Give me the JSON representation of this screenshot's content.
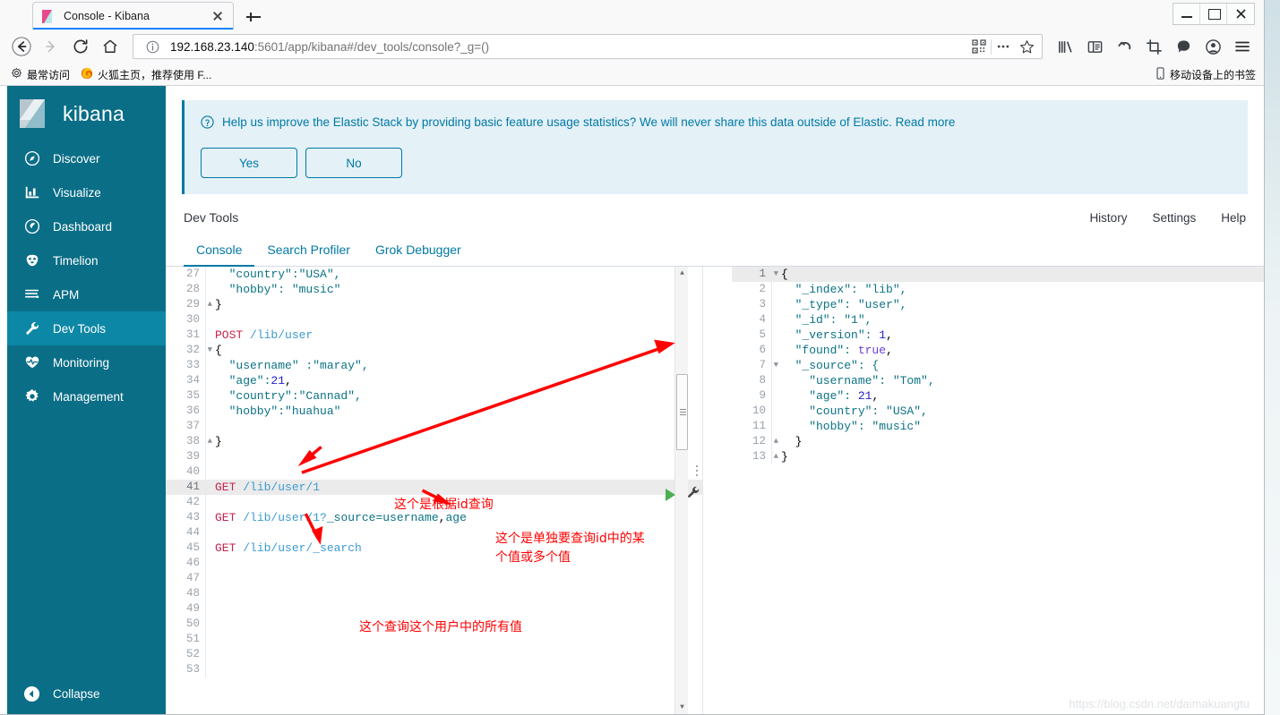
{
  "browser": {
    "tab": {
      "title": "Console - Kibana",
      "favicon": "kibana-favicon",
      "close": "×"
    },
    "newtab_tooltip": "+",
    "window_buttons": {
      "minimize": "minimize-icon",
      "maximize": "maximize-icon",
      "close": "✕"
    },
    "nav": {
      "back": "back-arrow-icon",
      "forward": "forward-arrow-icon",
      "reload": "reload-icon",
      "home": "home-icon"
    },
    "url": {
      "host": "192.168.23.140",
      "rest": ":5601/app/kibana#/dev_tools/console?_g=()",
      "full": "192.168.23.140:5601/app/kibana#/dev_tools/console?_g=()",
      "info_icon": "info-circle-icon",
      "qr_icon": "qr-code-icon",
      "more_icon": "ellipsis-icon",
      "bookmark_icon": "star-icon"
    },
    "toolbar_icons": [
      "library-icon",
      "sidebar-icon",
      "undo-icon",
      "screenshot-icon",
      "pocket-icon",
      "account-icon",
      "menu-icon"
    ],
    "bookmarks": {
      "most_visited": "最常访问",
      "firefox_home": "火狐主页，推荐使用 F...",
      "mobile": "移动设备上的书签"
    }
  },
  "sidebar": {
    "logo_text": "kibana",
    "items": [
      {
        "label": "Discover",
        "icon": "compass-icon",
        "active": false
      },
      {
        "label": "Visualize",
        "icon": "bar-chart-icon",
        "active": false
      },
      {
        "label": "Dashboard",
        "icon": "dashboard-icon",
        "active": false
      },
      {
        "label": "Timelion",
        "icon": "timelion-icon",
        "active": false
      },
      {
        "label": "APM",
        "icon": "apm-icon",
        "active": false
      },
      {
        "label": "Dev Tools",
        "icon": "wrench-icon",
        "active": true
      },
      {
        "label": "Monitoring",
        "icon": "heartbeat-icon",
        "active": false
      },
      {
        "label": "Management",
        "icon": "gear-icon",
        "active": false
      }
    ],
    "collapse": {
      "label": "Collapse",
      "icon": "collapse-arrow-icon"
    }
  },
  "banner": {
    "icon": "question-circle-icon",
    "message": "Help us improve the Elastic Stack by providing basic feature usage statistics? We will never share this data outside of Elastic.",
    "link": "Read more",
    "yes": "Yes",
    "no": "No"
  },
  "devtools": {
    "title": "Dev Tools",
    "links": [
      "History",
      "Settings",
      "Help"
    ],
    "tabs": [
      {
        "label": "Console",
        "active": true
      },
      {
        "label": "Search Profiler",
        "active": false
      },
      {
        "label": "Grok Debugger",
        "active": false
      }
    ]
  },
  "request_editor": {
    "first_visible_line": 27,
    "lines": [
      {
        "n": 27,
        "fold": "",
        "tokens": [
          {
            "t": "  \"country\":\"USA\",",
            "c": "str"
          }
        ]
      },
      {
        "n": 28,
        "fold": "",
        "tokens": [
          {
            "t": "  \"hobby\": \"music\"",
            "c": "str"
          }
        ]
      },
      {
        "n": 29,
        "fold": "▲",
        "tokens": [
          {
            "t": "}",
            "c": "punc"
          }
        ]
      },
      {
        "n": 30,
        "fold": "",
        "tokens": [
          {
            "t": "",
            "c": "punc"
          }
        ]
      },
      {
        "n": 31,
        "fold": "",
        "tokens": [
          {
            "t": "POST ",
            "c": "kw"
          },
          {
            "t": "/lib/user",
            "c": "url"
          }
        ]
      },
      {
        "n": 32,
        "fold": "▼",
        "tokens": [
          {
            "t": "{",
            "c": "punc"
          }
        ]
      },
      {
        "n": 33,
        "fold": "",
        "tokens": [
          {
            "t": "  \"username\" :\"maray\",",
            "c": "str"
          }
        ]
      },
      {
        "n": 34,
        "fold": "",
        "tokens": [
          {
            "t": "  \"age\":",
            "c": "str"
          },
          {
            "t": "21",
            "c": "num"
          },
          {
            "t": ",",
            "c": "punc"
          }
        ]
      },
      {
        "n": 35,
        "fold": "",
        "tokens": [
          {
            "t": "  \"country\":\"Cannad\",",
            "c": "str"
          }
        ]
      },
      {
        "n": 36,
        "fold": "",
        "tokens": [
          {
            "t": "  \"hobby\":\"huahua\"",
            "c": "str"
          }
        ]
      },
      {
        "n": 37,
        "fold": "",
        "tokens": [
          {
            "t": "",
            "c": "punc"
          }
        ]
      },
      {
        "n": 38,
        "fold": "▲",
        "tokens": [
          {
            "t": "}",
            "c": "punc"
          }
        ]
      },
      {
        "n": 39,
        "fold": "",
        "tokens": [
          {
            "t": "",
            "c": "punc"
          }
        ]
      },
      {
        "n": 40,
        "fold": "",
        "tokens": [
          {
            "t": "",
            "c": "punc"
          }
        ]
      },
      {
        "n": 41,
        "fold": "",
        "active": true,
        "tokens": [
          {
            "t": "GET ",
            "c": "kw"
          },
          {
            "t": "/lib/user/1",
            "c": "url"
          }
        ]
      },
      {
        "n": 42,
        "fold": "",
        "tokens": [
          {
            "t": "",
            "c": "punc"
          }
        ]
      },
      {
        "n": 43,
        "fold": "",
        "tokens": [
          {
            "t": "GET ",
            "c": "kw"
          },
          {
            "t": "/lib/user/1?",
            "c": "url"
          },
          {
            "t": "_source=username",
            "c": "str"
          },
          {
            "t": ",",
            "c": "punc"
          },
          {
            "t": "age",
            "c": "str"
          }
        ]
      },
      {
        "n": 44,
        "fold": "",
        "tokens": [
          {
            "t": "",
            "c": "punc"
          }
        ]
      },
      {
        "n": 45,
        "fold": "",
        "tokens": [
          {
            "t": "GET ",
            "c": "kw"
          },
          {
            "t": "/lib/user/_search",
            "c": "url"
          }
        ]
      },
      {
        "n": 46,
        "fold": "",
        "tokens": [
          {
            "t": "",
            "c": "punc"
          }
        ]
      },
      {
        "n": 47,
        "fold": "",
        "tokens": [
          {
            "t": "",
            "c": "punc"
          }
        ]
      },
      {
        "n": 48,
        "fold": "",
        "tokens": [
          {
            "t": "",
            "c": "punc"
          }
        ]
      },
      {
        "n": 49,
        "fold": "",
        "tokens": [
          {
            "t": "",
            "c": "punc"
          }
        ]
      },
      {
        "n": 50,
        "fold": "",
        "tokens": [
          {
            "t": "",
            "c": "punc"
          }
        ]
      },
      {
        "n": 51,
        "fold": "",
        "tokens": [
          {
            "t": "",
            "c": "punc"
          }
        ]
      },
      {
        "n": 52,
        "fold": "",
        "tokens": [
          {
            "t": "",
            "c": "punc"
          }
        ]
      },
      {
        "n": 53,
        "fold": "",
        "tokens": [
          {
            "t": "",
            "c": "punc"
          }
        ]
      }
    ],
    "run_button": "play-icon",
    "wrench_button": "wrench-icon"
  },
  "response_editor": {
    "lines": [
      {
        "n": 1,
        "fold": "▼",
        "active": true,
        "tokens": [
          {
            "t": "{",
            "c": "punc"
          }
        ]
      },
      {
        "n": 2,
        "fold": "",
        "tokens": [
          {
            "t": "  \"_index\": \"lib\",",
            "c": "str"
          }
        ]
      },
      {
        "n": 3,
        "fold": "",
        "tokens": [
          {
            "t": "  \"_type\": \"user\",",
            "c": "str"
          }
        ]
      },
      {
        "n": 4,
        "fold": "",
        "tokens": [
          {
            "t": "  \"_id\": \"1\",",
            "c": "str"
          }
        ]
      },
      {
        "n": 5,
        "fold": "",
        "tokens": [
          {
            "t": "  \"_version\": ",
            "c": "str"
          },
          {
            "t": "1",
            "c": "num"
          },
          {
            "t": ",",
            "c": "punc"
          }
        ]
      },
      {
        "n": 6,
        "fold": "",
        "tokens": [
          {
            "t": "  \"found\": ",
            "c": "str"
          },
          {
            "t": "true",
            "c": "bool"
          },
          {
            "t": ",",
            "c": "punc"
          }
        ]
      },
      {
        "n": 7,
        "fold": "▼",
        "tokens": [
          {
            "t": "  \"_source\": {",
            "c": "str"
          }
        ]
      },
      {
        "n": 8,
        "fold": "",
        "tokens": [
          {
            "t": "    \"username\": \"Tom\",",
            "c": "str"
          }
        ]
      },
      {
        "n": 9,
        "fold": "",
        "tokens": [
          {
            "t": "    \"age\": ",
            "c": "str"
          },
          {
            "t": "21",
            "c": "num"
          },
          {
            "t": ",",
            "c": "punc"
          }
        ]
      },
      {
        "n": 10,
        "fold": "",
        "tokens": [
          {
            "t": "    \"country\": \"USA\",",
            "c": "str"
          }
        ]
      },
      {
        "n": 11,
        "fold": "",
        "tokens": [
          {
            "t": "    \"hobby\": \"music\"",
            "c": "str"
          }
        ]
      },
      {
        "n": 12,
        "fold": "▲",
        "tokens": [
          {
            "t": "  }",
            "c": "punc"
          }
        ]
      },
      {
        "n": 13,
        "fold": "▲",
        "tokens": [
          {
            "t": "}",
            "c": "punc"
          }
        ]
      }
    ]
  },
  "annotations": [
    {
      "id": "anno-id-query",
      "text": "这个是根据id查询"
    },
    {
      "id": "anno-source-fields",
      "text": "这个是单独要查询id中的某\n个值或多个值"
    },
    {
      "id": "anno-search-all",
      "text": "这个查询这个用户中的所有值"
    }
  ],
  "watermark": "https://blog.csdn.net/daimakuangtu",
  "colors": {
    "kibana_sidebar": "#0a6e87",
    "kibana_active": "#0d87a6",
    "accent": "#0079a5",
    "banner_bg": "#e4f1f7",
    "annotation_red": "#ff0000",
    "run_green": "#4caf50"
  }
}
